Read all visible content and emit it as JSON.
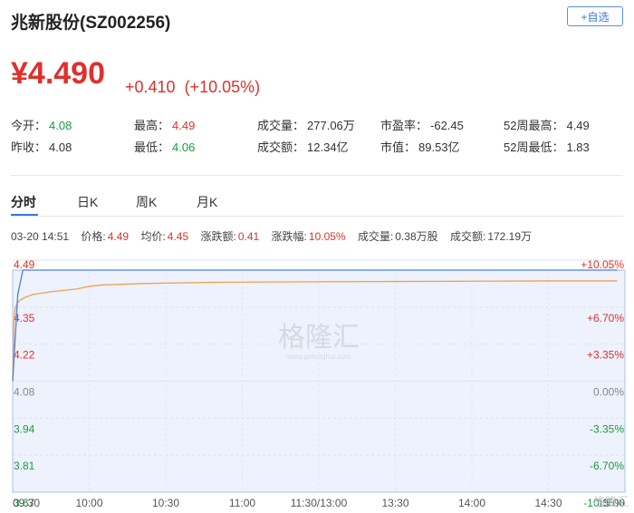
{
  "header": {
    "title": "兆新股份(SZ002256)",
    "watch_label": "+自选"
  },
  "quote": {
    "price": "¥4.490",
    "change": "+0.410",
    "change_pct": "(+10.05%)"
  },
  "stats": [
    {
      "label": "今开：",
      "value": "4.08",
      "tone": "green"
    },
    {
      "label": "最高：",
      "value": "4.49",
      "tone": "red"
    },
    {
      "label": "成交量：",
      "value": "277.06万",
      "tone": "normal"
    },
    {
      "label": "市盈率：",
      "value": "-62.45",
      "tone": "normal"
    },
    {
      "label": "52周最高：",
      "value": "4.49",
      "tone": "normal"
    },
    {
      "label": "昨收：",
      "value": "4.08",
      "tone": "normal"
    },
    {
      "label": "最低：",
      "value": "4.06",
      "tone": "green"
    },
    {
      "label": "成交额：",
      "value": "12.34亿",
      "tone": "normal"
    },
    {
      "label": "市值：",
      "value": "89.53亿",
      "tone": "normal"
    },
    {
      "label": "52周最低：",
      "value": "1.83",
      "tone": "normal"
    }
  ],
  "tabs": [
    "分时",
    "日K",
    "周K",
    "月K"
  ],
  "info": {
    "time": "03-20 14:51",
    "price_label": "价格:",
    "price": "4.49",
    "avg_label": "均价:",
    "avg": "4.45",
    "chg_label": "涨跌额:",
    "chg": "0.41",
    "chgpct_label": "涨跌幅:",
    "chgpct": "10.05%",
    "vol_label": "成交量:",
    "vol": "0.38万股",
    "amt_label": "成交额:",
    "amt": "172.19万"
  },
  "watermark": {
    "text": "格隆汇",
    "sub": "www.gelonghui.com",
    "corner": "格隆汇"
  },
  "chart_data": {
    "type": "line",
    "ylim": [
      3.67,
      4.49
    ],
    "prev_close": 4.08,
    "y_ticks": [
      "4.49",
      "4.35",
      "4.22",
      "4.08",
      "3.94",
      "3.81",
      "3.67"
    ],
    "y_ticks_right": [
      "+10.05%",
      "+6.70%",
      "+3.35%",
      "0.00%",
      "-3.35%",
      "-6.70%",
      "-10.05%"
    ],
    "x_ticks": [
      "09:30",
      "10:00",
      "10:30",
      "11:00",
      "11:30/13:00",
      "13:30",
      "14:00",
      "14:30",
      "15:00"
    ],
    "series": [
      {
        "values_t": [
          0,
          0.5,
          1,
          2,
          3,
          5,
          8,
          15,
          25,
          30,
          35,
          50,
          60,
          80,
          100,
          120,
          150,
          180,
          210,
          237
        ],
        "values": [
          4.08,
          4.3,
          4.35,
          4.37,
          4.38,
          4.39,
          4.4,
          4.41,
          4.42,
          4.43,
          4.435,
          4.44,
          4.442,
          4.445,
          4.446,
          4.447,
          4.448,
          4.449,
          4.45,
          4.45
        ],
        "color": "#f0a050"
      },
      {
        "values_t": [
          0,
          2,
          4,
          237
        ],
        "values": [
          4.08,
          4.4,
          4.49,
          4.49
        ],
        "color": "#4a80e0"
      }
    ],
    "colors": {
      "up": "#e0302b",
      "down": "#1a9a3a",
      "flat": "#888888",
      "fill": "#eef2fc",
      "border": "#a8c0f0"
    }
  }
}
